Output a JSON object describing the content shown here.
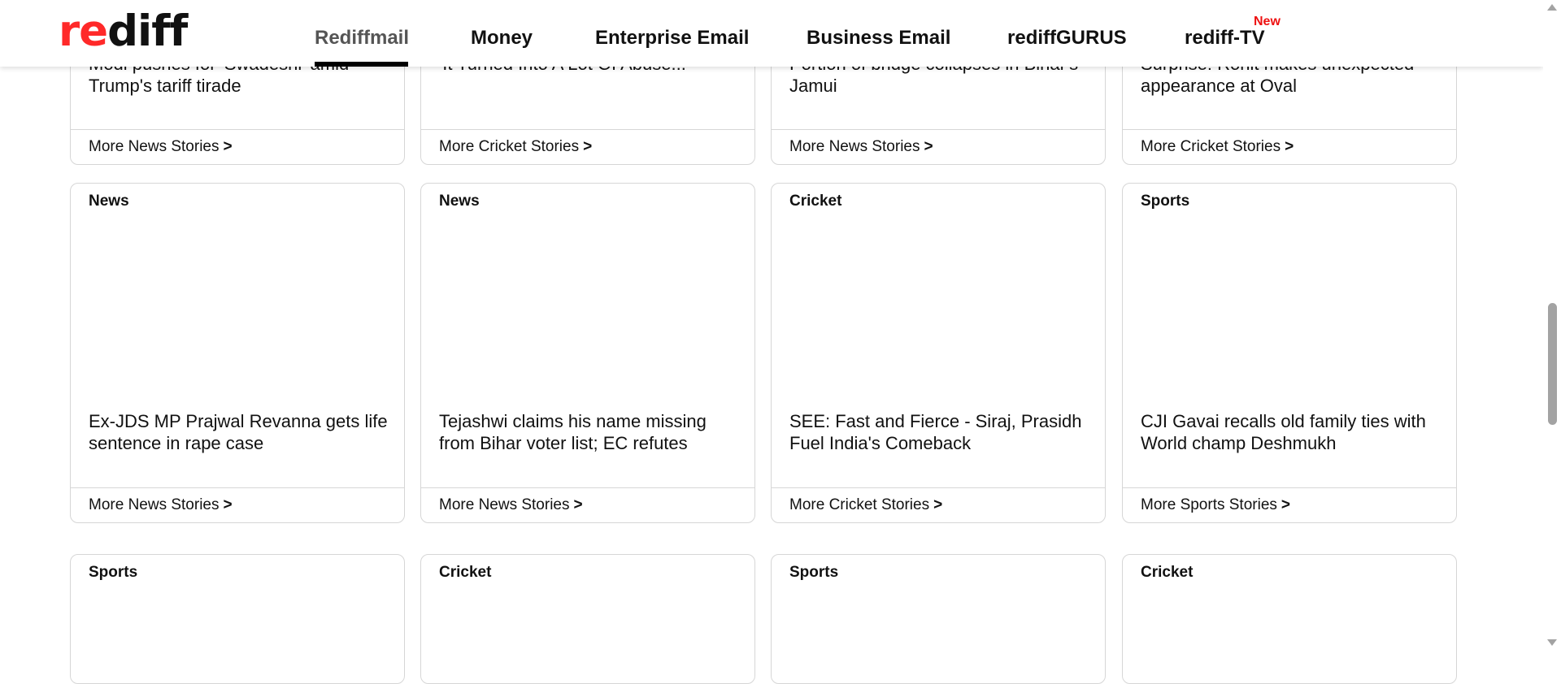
{
  "header": {
    "logo": {
      "red_part": "re",
      "black_part": "diff"
    },
    "nav": [
      {
        "label": "Rediffmail",
        "active": true
      },
      {
        "label": "Money"
      },
      {
        "label": "Enterprise Email"
      },
      {
        "label": "Business Email"
      },
      {
        "label": "rediffGURUS"
      },
      {
        "label": "rediff-TV"
      }
    ],
    "new_badge": "New"
  },
  "cards_row0": [
    {
      "headline": "Modi pushes for 'Swadeshi' amid Trump's tariff tirade",
      "more": "More News Stories"
    },
    {
      "headline": "'It Turned Into A Lot Of Abuse...'",
      "more": "More Cricket Stories"
    },
    {
      "headline": "Portion of bridge collapses in Bihar's Jamui",
      "more": "More News Stories"
    },
    {
      "headline": "Surprise! Rohit makes unexpected appearance at Oval",
      "more": "More Cricket Stories"
    }
  ],
  "cards_row1": [
    {
      "category": "News",
      "headline": "Ex-JDS MP Prajwal Revanna gets life sentence in rape case",
      "more": "More News Stories"
    },
    {
      "category": "News",
      "headline": "Tejashwi claims his name missing from Bihar voter list; EC refutes",
      "more": "More News Stories"
    },
    {
      "category": "Cricket",
      "headline": "SEE: Fast and Fierce - Siraj, Prasidh Fuel India's Comeback",
      "more": "More Cricket Stories"
    },
    {
      "category": "Sports",
      "headline": "CJI Gavai recalls old family ties with World champ Deshmukh",
      "more": "More Sports Stories"
    }
  ],
  "cards_row2": [
    {
      "category": "Sports"
    },
    {
      "category": "Cricket"
    },
    {
      "category": "Sports"
    },
    {
      "category": "Cricket"
    }
  ],
  "more_chevron": ">",
  "colors": {
    "brand_red": "#ff2929",
    "text": "#111111",
    "active_nav": "#555555",
    "new_badge": "#ee1111",
    "card_border": "#d6d6d6"
  }
}
